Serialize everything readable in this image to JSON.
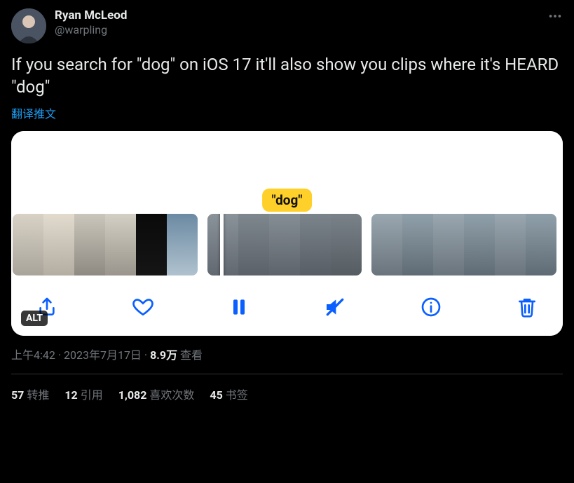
{
  "author": {
    "display_name": "Ryan McLeod",
    "handle": "@warpling"
  },
  "tweet_text": "If you search for \"dog\" on iOS 17 it'll also show you clips where it's HEARD \"dog\"",
  "translate_label": "翻译推文",
  "media": {
    "caption_bubble": "\"dog\"",
    "alt_badge": "ALT",
    "controls": {
      "share": "share-icon",
      "like": "heart-icon",
      "pause": "pause-icon",
      "mute": "mute-icon",
      "info": "info-icon",
      "trash": "trash-icon"
    }
  },
  "meta": {
    "time": "上午4:42",
    "dot1": " · ",
    "date": "2023年7月17日",
    "dot2": " · ",
    "views_number": "8.9万",
    "views_label": " 查看"
  },
  "stats": {
    "retweets_num": "57",
    "retweets_label": "转推",
    "quotes_num": "12",
    "quotes_label": "引用",
    "likes_num": "1,082",
    "likes_label": "喜欢次数",
    "bookmarks_num": "45",
    "bookmarks_label": "书签"
  }
}
